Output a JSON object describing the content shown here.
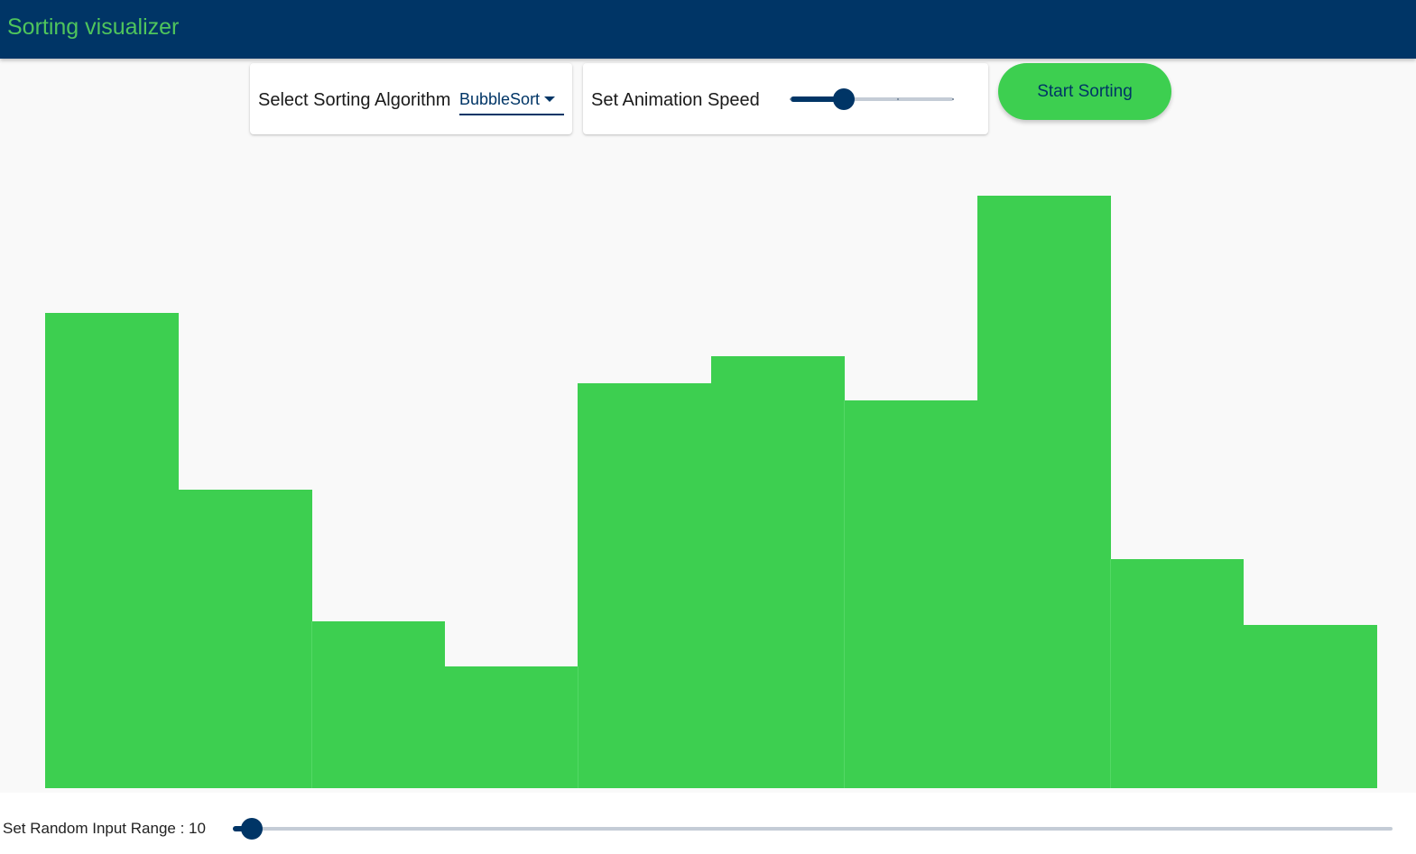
{
  "app": {
    "title": "Sorting visualizer"
  },
  "controls": {
    "algorithm_label": "Select Sorting Algorithm",
    "algorithm_value": "BubbleSort",
    "speed_label": "Set Animation Speed",
    "speed_value_fraction": 0.33,
    "speed_marks_fraction": [
      0.0,
      0.66,
      1.0
    ],
    "start_button_label": "Start Sorting"
  },
  "range": {
    "label_prefix": "Set Random Input Range : ",
    "value": "10",
    "slider_fraction": 0.016
  },
  "colors": {
    "appbar": "#003566",
    "accent_green": "#3dcf50",
    "title_green": "#4fc55c",
    "slider_dark": "#003566"
  },
  "chart_data": {
    "type": "bar",
    "values": [
      527,
      331,
      185,
      135,
      449,
      479,
      430,
      657,
      254,
      181
    ],
    "ylim": [
      0,
      724
    ]
  }
}
